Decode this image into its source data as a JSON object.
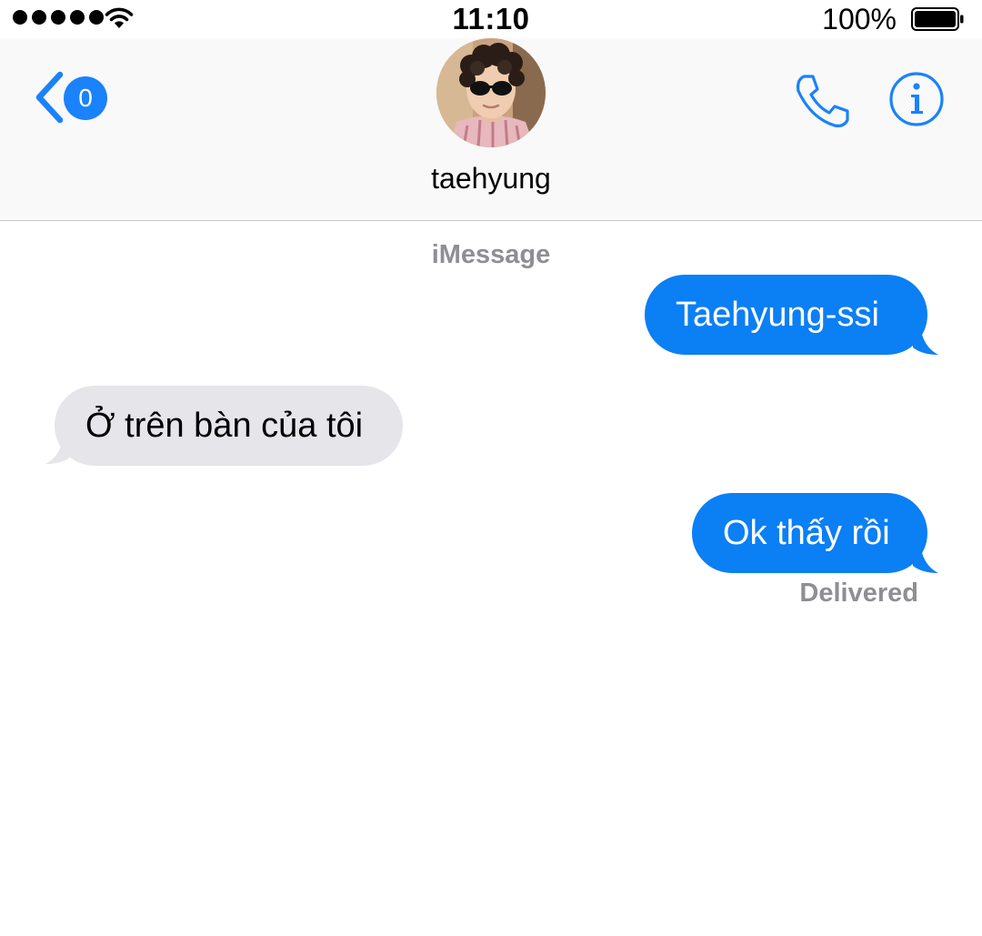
{
  "status_bar": {
    "time": "11:10",
    "battery_percent": "100%",
    "signal_bars": 5
  },
  "header": {
    "back_badge_count": "0",
    "contact_name": "taehyung",
    "back_icon": "chevron-left-icon",
    "call_icon": "phone-icon",
    "details_icon": "info-icon"
  },
  "conversation": {
    "service_label": "iMessage",
    "messages": [
      {
        "direction": "outgoing",
        "text": "Taehyung-ssi"
      },
      {
        "direction": "incoming",
        "text": "Ở trên bàn của tôi"
      },
      {
        "direction": "outgoing",
        "text": "Ok thấy rồi"
      }
    ],
    "delivery_status": "Delivered"
  },
  "colors": {
    "accent": "#0b7ff4",
    "incoming_bubble": "#e5e5ea",
    "secondary_text": "#8e8e93",
    "header_background": "#f9f9f9"
  }
}
